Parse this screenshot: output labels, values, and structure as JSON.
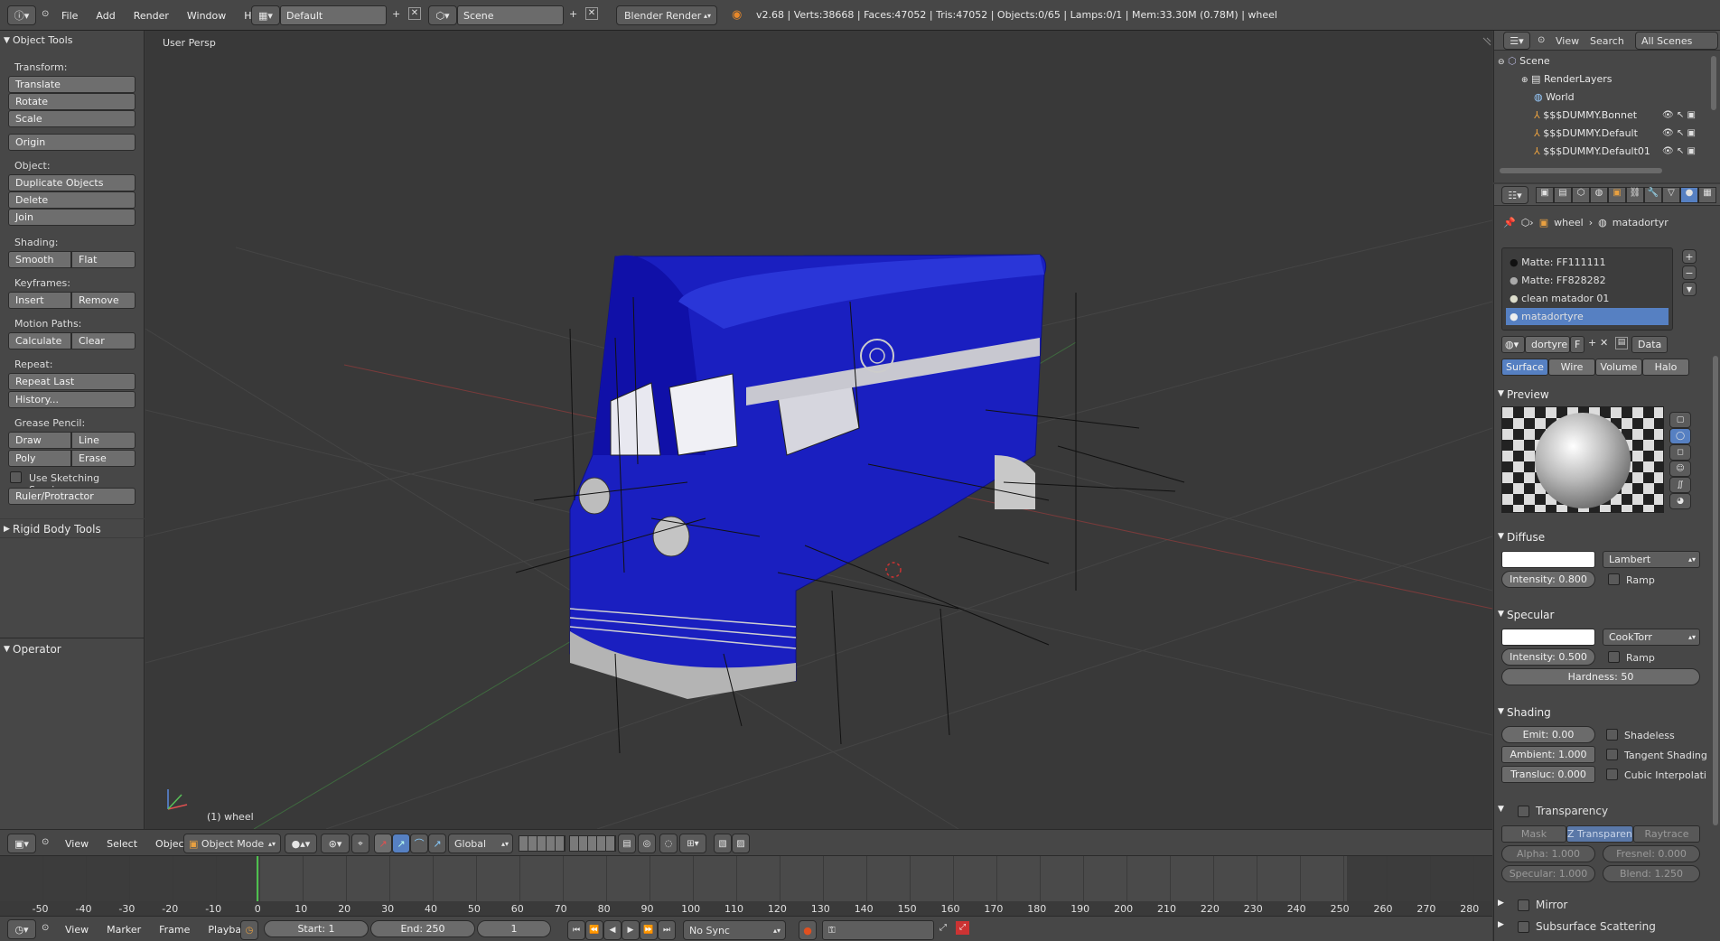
{
  "topbar": {
    "menus": [
      "File",
      "Add",
      "Render",
      "Window",
      "Help"
    ],
    "layout": "Default",
    "scene": "Scene",
    "engine": "Blender Render",
    "stats": "v2.68 | Verts:38668 | Faces:47052 | Tris:47052 | Objects:0/65 | Lamps:0/1 | Mem:33.30M (0.78M) | wheel"
  },
  "tools": {
    "header": "Object Tools",
    "transform_label": "Transform:",
    "translate": "Translate",
    "rotate": "Rotate",
    "scale": "Scale",
    "origin": "Origin",
    "object_label": "Object:",
    "duplicate": "Duplicate Objects",
    "delete": "Delete",
    "join": "Join",
    "shading_label": "Shading:",
    "smooth": "Smooth",
    "flat": "Flat",
    "keyframes_label": "Keyframes:",
    "insert": "Insert",
    "remove": "Remove",
    "motion_label": "Motion Paths:",
    "calculate": "Calculate",
    "clear": "Clear",
    "repeat_label": "Repeat:",
    "repeat_last": "Repeat Last",
    "history": "History...",
    "grease_label": "Grease Pencil:",
    "draw": "Draw",
    "line": "Line",
    "poly": "Poly",
    "erase": "Erase",
    "sketching": "Use Sketching Sessions",
    "ruler": "Ruler/Protractor",
    "rigid": "Rigid Body Tools",
    "operator": "Operator"
  },
  "viewport": {
    "persp": "User Persp",
    "selected": "(1) wheel"
  },
  "view3d_header": {
    "menus": [
      "View",
      "Select",
      "Object"
    ],
    "mode": "Object Mode",
    "orientation": "Global"
  },
  "timeline": {
    "ticks": [
      -50,
      -40,
      -30,
      -20,
      -10,
      0,
      10,
      20,
      30,
      40,
      50,
      60,
      70,
      80,
      90,
      100,
      110,
      120,
      130,
      140,
      150,
      160,
      170,
      180,
      190,
      200,
      210,
      220,
      230,
      240,
      250,
      260,
      270,
      280
    ],
    "current": 0
  },
  "bottombar": {
    "menus": [
      "View",
      "Marker",
      "Frame",
      "Playback"
    ],
    "start": "Start: 1",
    "end": "End: 250",
    "frame": "1",
    "sync": "No Sync"
  },
  "outliner": {
    "view": "View",
    "search": "Search",
    "filter": "All Scenes",
    "rows": [
      "Scene",
      "RenderLayers",
      "World",
      "$$$DUMMY.Bonnet",
      "$$$DUMMY.Default",
      "$$$DUMMY.Default01"
    ]
  },
  "properties": {
    "breadcrumb_obj": "wheel",
    "breadcrumb_mat": "matadortyr",
    "materials": [
      "Matte: FF111111",
      "Matte: FF828282",
      "clean matador 01",
      "matadortyre"
    ],
    "mat_name": "dortyre",
    "mat_flag": "F",
    "data": "Data",
    "tabs": [
      "Surface",
      "Wire",
      "Volume",
      "Halo"
    ],
    "preview": "Preview",
    "diffuse": "Diffuse",
    "diffuse_shader": "Lambert",
    "diffuse_intensity": "Intensity: 0.800",
    "ramp": "Ramp",
    "specular": "Specular",
    "specular_shader": "CookTorr",
    "specular_intensity": "Intensity: 0.500",
    "hardness": "Hardness: 50",
    "shading": "Shading",
    "emit": "Emit: 0.00",
    "shadeless": "Shadeless",
    "ambient": "Ambient: 1.000",
    "tangent": "Tangent Shading",
    "transluc": "Transluc: 0.000",
    "cubic": "Cubic Interpolati",
    "transparency": "Transparency",
    "trans_tabs": [
      "Mask",
      "Z Transparenc",
      "Raytrace"
    ],
    "alpha": "Alpha: 1.000",
    "fresnel": "Fresnel: 0.000",
    "spec": "Specular: 1.000",
    "blend": "Blend: 1.250",
    "mirror": "Mirror",
    "sss": "Subsurface Scattering"
  },
  "colors": {
    "accent": "#5680c2",
    "van": "#1a1fc0"
  }
}
